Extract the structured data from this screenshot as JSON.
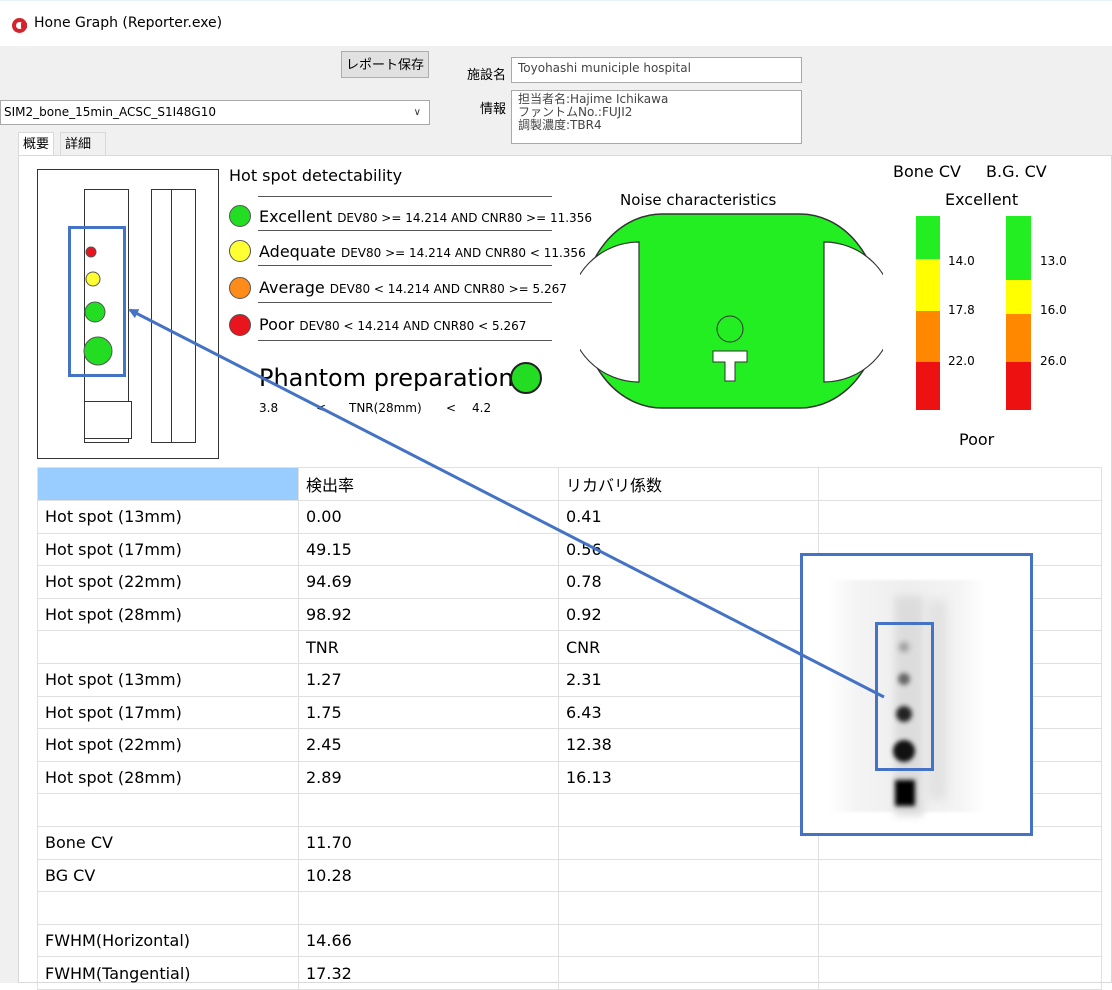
{
  "window": {
    "title": "Hone Graph (Reporter.exe)"
  },
  "toolbar": {
    "save_label": "レポート保存"
  },
  "facility": {
    "label": "施設名",
    "value": "Toyohashi municiple hospital"
  },
  "info": {
    "label": "情報",
    "lines": [
      "担当者名:Hajime Ichikawa",
      "ファントムNo.:FUJI2",
      "調製濃度:TBR4"
    ]
  },
  "dataset_select": {
    "value": "SIM2_bone_15min_ACSC_S1I48G10"
  },
  "tabs": [
    {
      "label": "概要"
    },
    {
      "label": "詳細"
    }
  ],
  "detectability": {
    "title": "Hot spot detectability",
    "levels": [
      {
        "name": "Excellent",
        "criteria": "DEV80 >= 14.214 AND CNR80 >= 11.356",
        "color": "#22dd22"
      },
      {
        "name": "Adequate",
        "criteria": "DEV80 >= 14.214 AND CNR80 < 11.356",
        "color": "#ffff33"
      },
      {
        "name": "Average",
        "criteria": "DEV80 < 14.214 AND CNR80 >= 5.267",
        "color": "#ff8c1a"
      },
      {
        "name": "Poor",
        "criteria": "DEV80 < 14.214 AND CNR80 < 5.267",
        "color": "#e8141e"
      }
    ]
  },
  "phantom_prep": {
    "title": "Phantom preparation",
    "low": "3.8",
    "lt1": "<",
    "mid": "TNR(28mm)",
    "lt2": "<",
    "high": "4.2",
    "status_color": "#22dd22"
  },
  "noise": {
    "title": "Noise characteristics",
    "color": "#22ee22"
  },
  "cv_scale": {
    "bone_label": "Bone CV",
    "bg_label": "B.G. CV",
    "top_label": "Excellent",
    "bottom_label": "Poor",
    "bone_thresholds": [
      "14.0",
      "17.8",
      "22.0"
    ],
    "bg_thresholds": [
      "13.0",
      "16.0",
      "26.0"
    ],
    "colors": [
      "#22ee22",
      "#ffff00",
      "#ff8800",
      "#ee1111"
    ]
  },
  "table": {
    "rows": [
      [
        "",
        "検出率",
        "リカバリ係数",
        ""
      ],
      [
        "Hot spot (13mm)",
        "0.00",
        "0.41",
        ""
      ],
      [
        "Hot spot (17mm)",
        "49.15",
        "0.56",
        ""
      ],
      [
        "Hot spot (22mm)",
        "94.69",
        "0.78",
        ""
      ],
      [
        "Hot spot (28mm)",
        "98.92",
        "0.92",
        ""
      ],
      [
        "",
        "TNR",
        "CNR",
        ""
      ],
      [
        "Hot spot (13mm)",
        "1.27",
        "2.31",
        ""
      ],
      [
        "Hot spot (17mm)",
        "1.75",
        "6.43",
        ""
      ],
      [
        "Hot spot (22mm)",
        "2.45",
        "12.38",
        ""
      ],
      [
        "Hot spot (28mm)",
        "2.89",
        "16.13",
        ""
      ],
      [
        "",
        "",
        "",
        ""
      ],
      [
        "Bone CV",
        "11.70",
        "",
        ""
      ],
      [
        "BG CV",
        "10.28",
        "",
        ""
      ],
      [
        "",
        "",
        "",
        ""
      ],
      [
        "FWHM(Horizontal)",
        "14.66",
        "",
        ""
      ],
      [
        "FWHM(Tangential)",
        "17.32",
        "",
        ""
      ]
    ]
  },
  "annotation": {
    "color": "#4472c4"
  }
}
